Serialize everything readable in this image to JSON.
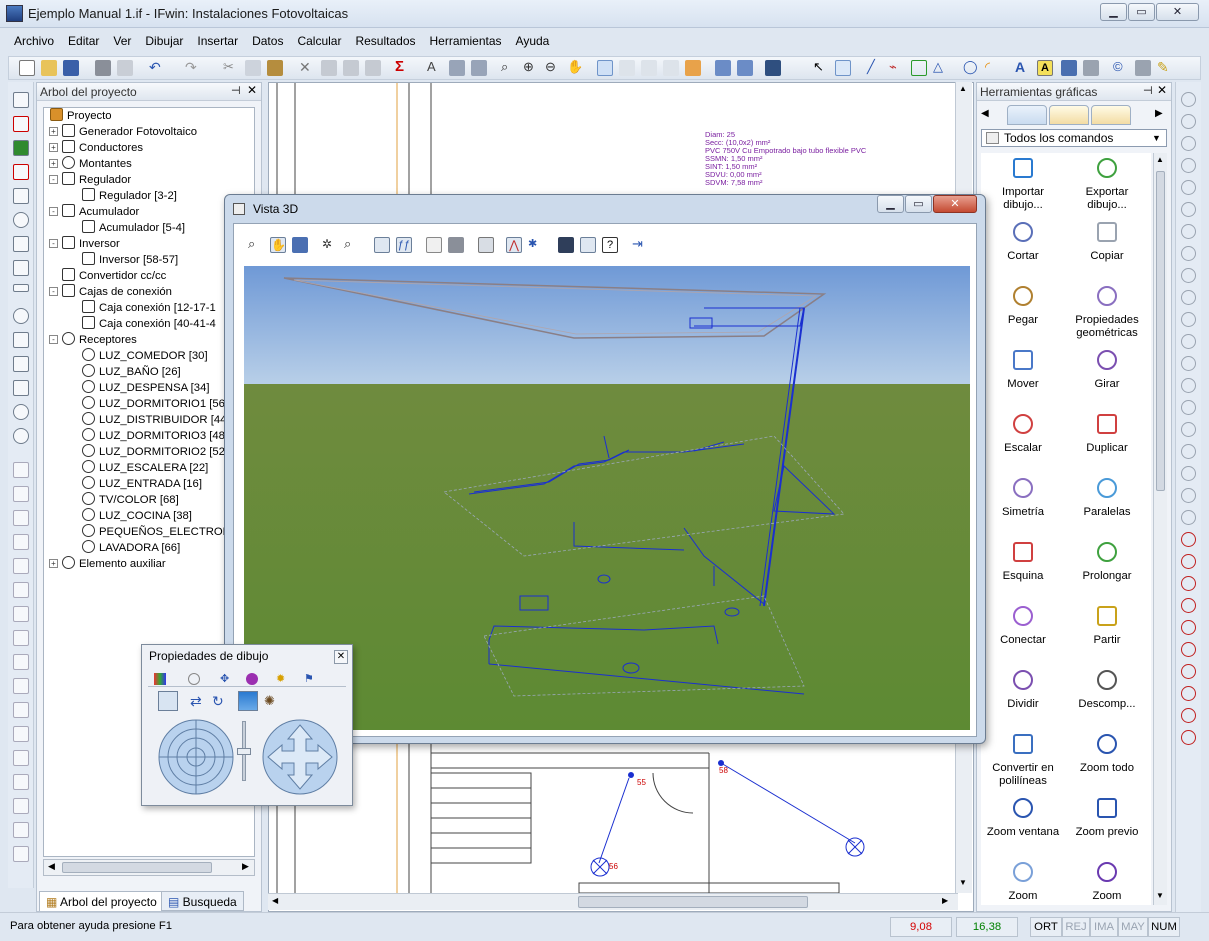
{
  "app": {
    "title": "Ejemplo Manual 1.if - IFwin: Instalaciones Fotovoltaicas"
  },
  "menu": [
    "Archivo",
    "Editar",
    "Ver",
    "Dibujar",
    "Insertar",
    "Datos",
    "Calcular",
    "Resultados",
    "Herramientas",
    "Ayuda"
  ],
  "tree": {
    "title": "Arbol del proyecto",
    "items": [
      {
        "label": "Proyecto",
        "level": 0
      },
      {
        "label": "Generador Fotovoltaico",
        "level": 1,
        "exp": "+"
      },
      {
        "label": "Conductores",
        "level": 1,
        "exp": "+"
      },
      {
        "label": "Montantes",
        "level": 1,
        "exp": "+"
      },
      {
        "label": "Regulador",
        "level": 1,
        "exp": "-"
      },
      {
        "label": "Regulador [3-2]",
        "level": 2
      },
      {
        "label": "Acumulador",
        "level": 1,
        "exp": "-"
      },
      {
        "label": "Acumulador [5-4]",
        "level": 2
      },
      {
        "label": "Inversor",
        "level": 1,
        "exp": "-"
      },
      {
        "label": "Inversor [58-57]",
        "level": 2
      },
      {
        "label": "Convertidor cc/cc",
        "level": 1
      },
      {
        "label": "Cajas de conexión",
        "level": 1,
        "exp": "-"
      },
      {
        "label": "Caja conexión [12-17-1",
        "level": 2
      },
      {
        "label": "Caja conexión [40-41-4",
        "level": 2
      },
      {
        "label": "Receptores",
        "level": 1,
        "exp": "-"
      },
      {
        "label": "LUZ_COMEDOR [30]",
        "level": 2
      },
      {
        "label": "LUZ_BAÑO [26]",
        "level": 2
      },
      {
        "label": "LUZ_DESPENSA [34]",
        "level": 2
      },
      {
        "label": "LUZ_DORMITORIO1 [56",
        "level": 2
      },
      {
        "label": "LUZ_DISTRIBUIDOR [44",
        "level": 2
      },
      {
        "label": "LUZ_DORMITORIO3 [48",
        "level": 2
      },
      {
        "label": "LUZ_DORMITORIO2 [52",
        "level": 2
      },
      {
        "label": "LUZ_ESCALERA [22]",
        "level": 2
      },
      {
        "label": "LUZ_ENTRADA [16]",
        "level": 2
      },
      {
        "label": "TV/COLOR [68]",
        "level": 2
      },
      {
        "label": "LUZ_COCINA [38]",
        "level": 2
      },
      {
        "label": "PEQUEÑOS_ELECTRODO",
        "level": 2
      },
      {
        "label": "LAVADORA [66]",
        "level": 2
      },
      {
        "label": "Elemento auxiliar",
        "level": 1,
        "exp": "+"
      }
    ],
    "tabs": [
      "Arbol del proyecto",
      "Busqueda"
    ]
  },
  "drawing": {
    "note": [
      "Diam: 25",
      "Secc: (10,0x2) mm²",
      "PVC 750V Cu Empotrado bajo tubo flexible PVC",
      "SSMN: 1,50 mm²",
      "SINT: 1,50 mm²",
      "SDVU: 0,00 mm²",
      "SDVM: 7,58 mm²"
    ],
    "labels": [
      "55",
      "56",
      "58"
    ]
  },
  "vista3d": {
    "title": "Vista 3D"
  },
  "props": {
    "title": "Propiedades de dibujo"
  },
  "right": {
    "title": "Herramientas gráficas",
    "select": "Todos los comandos",
    "tools": [
      {
        "label": "Importar dibujo...",
        "icon": "import-icon"
      },
      {
        "label": "Exportar dibujo...",
        "icon": "export-icon"
      },
      {
        "label": "Cortar",
        "icon": "scissors-icon"
      },
      {
        "label": "Copiar",
        "icon": "copy-icon"
      },
      {
        "label": "Pegar",
        "icon": "paste-icon"
      },
      {
        "label": "Propiedades geométricas",
        "icon": "properties-icon"
      },
      {
        "label": "Mover",
        "icon": "move-icon"
      },
      {
        "label": "Girar",
        "icon": "rotate-icon"
      },
      {
        "label": "Escalar",
        "icon": "scale-icon"
      },
      {
        "label": "Duplicar",
        "icon": "duplicate-icon"
      },
      {
        "label": "Simetría",
        "icon": "symmetry-icon"
      },
      {
        "label": "Paralelas",
        "icon": "parallel-icon"
      },
      {
        "label": "Esquina",
        "icon": "corner-icon"
      },
      {
        "label": "Prolongar",
        "icon": "extend-icon"
      },
      {
        "label": "Conectar",
        "icon": "connect-icon"
      },
      {
        "label": "Partir",
        "icon": "split-icon"
      },
      {
        "label": "Dividir",
        "icon": "divide-icon"
      },
      {
        "label": "Descomp...",
        "icon": "explode-icon"
      },
      {
        "label": "Convertir en polilíneas",
        "icon": "polyline-icon"
      },
      {
        "label": "Zoom todo",
        "icon": "zoom-all-icon"
      },
      {
        "label": "Zoom ventana",
        "icon": "zoom-window-icon"
      },
      {
        "label": "Zoom previo",
        "icon": "zoom-previous-icon"
      },
      {
        "label": "Zoom",
        "icon": "zoom-icon"
      },
      {
        "label": "Zoom",
        "icon": "zoom-in-icon"
      }
    ]
  },
  "status": {
    "help": "Para obtener ayuda presione F1",
    "x": "9,08",
    "y": "16,38",
    "flags": [
      "ORT",
      "REJ",
      "IMA",
      "MAY",
      "NUM"
    ]
  },
  "colors": {
    "accent": "#1f5fbf",
    "coordX": "#d40000",
    "coordY": "#008000",
    "wire": "#1a2fd0"
  }
}
